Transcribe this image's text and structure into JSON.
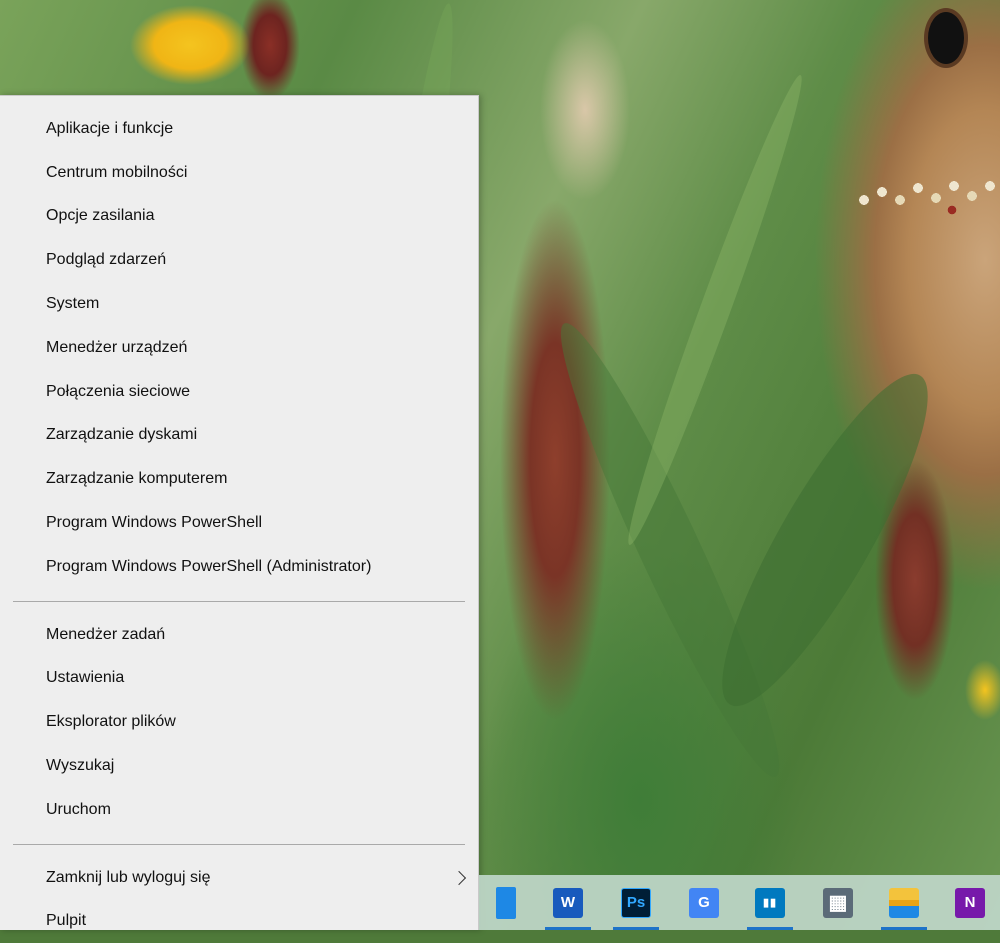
{
  "menu": {
    "group1": [
      {
        "label": "Aplikacje i funkcje"
      },
      {
        "label": "Centrum mobilności"
      },
      {
        "label": "Opcje zasilania"
      },
      {
        "label": "Podgląd zdarzeń"
      },
      {
        "label": "System"
      },
      {
        "label": "Menedżer urządzeń"
      },
      {
        "label": "Połączenia sieciowe"
      },
      {
        "label": "Zarządzanie dyskami"
      },
      {
        "label": "Zarządzanie komputerem"
      },
      {
        "label": "Program Windows PowerShell"
      },
      {
        "label": "Program Windows PowerShell (Administrator)"
      }
    ],
    "group2": [
      {
        "label": "Menedżer zadań"
      },
      {
        "label": "Ustawienia"
      },
      {
        "label": "Eksplorator plików"
      },
      {
        "label": "Wyszukaj"
      },
      {
        "label": "Uruchom"
      }
    ],
    "group3": [
      {
        "label": "Zamknij lub wyloguj się",
        "icon": "chevron-right-icon"
      },
      {
        "label": "Pulpit"
      }
    ]
  },
  "taskbar": {
    "apps": [
      {
        "name": "blue-app-icon",
        "color": "#1e88e5",
        "glyph": "",
        "active": false
      },
      {
        "name": "word-icon",
        "color": "#185abd",
        "glyph": "W",
        "active": true
      },
      {
        "name": "photoshop-icon",
        "color": "#001e36",
        "glyph": "Ps",
        "active": true
      },
      {
        "name": "google-translate-icon",
        "color": "#4285f4",
        "glyph": "G",
        "active": false
      },
      {
        "name": "trello-icon",
        "color": "#0079bf",
        "glyph": "▮▮",
        "active": true
      },
      {
        "name": "calculator-icon",
        "color": "#5b6b78",
        "glyph": "▦",
        "active": false
      },
      {
        "name": "file-explorer-icon",
        "color": "#f3c33c",
        "glyph": "",
        "active": true
      },
      {
        "name": "onenote-icon",
        "color": "#7719aa",
        "glyph": "N",
        "active": false
      }
    ]
  }
}
